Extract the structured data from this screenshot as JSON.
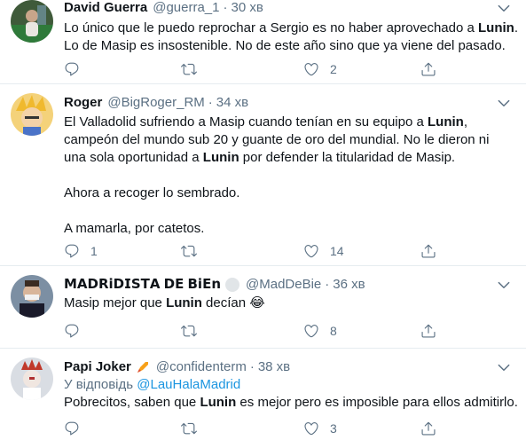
{
  "tweets": [
    {
      "name": "David Guerra",
      "handle": "@guerra_1",
      "sep": "·",
      "time": "30 хв",
      "lines": [
        [
          "Lo único que le puedo reprochar a Sergio es no haber aprovechado a ",
          "Lunin",
          "."
        ],
        [
          "Lo de Masip es insostenible. No de este año sino que ya viene del pasado.",
          "",
          ""
        ]
      ],
      "reply_count": "",
      "retweet_count": "",
      "like_count": "2"
    },
    {
      "name": "Roger",
      "handle": "@BigRoger_RM",
      "sep": "·",
      "time": "34 хв",
      "lines": [
        [
          "El Valladolid sufriendo a Masip cuando tenían en su equipo a ",
          "Lunin",
          ","
        ],
        [
          "campeón del mundo sub 20 y guante de oro del mundial. No le dieron ni",
          "",
          ""
        ],
        [
          "una sola oportunidad a ",
          "Lunin",
          " por defender la titularidad de Masip."
        ],
        [
          "",
          "",
          ""
        ],
        [
          "Ahora a recoger lo sembrado.",
          "",
          ""
        ],
        [
          "",
          "",
          ""
        ],
        [
          "A mamarla, por catetos.",
          "",
          ""
        ]
      ],
      "reply_count": "1",
      "retweet_count": "",
      "like_count": "14"
    },
    {
      "name": "𝗠𝗔𝗗𝗥𝗶𝗗𝗜𝗦𝗧𝗔 𝗗𝗘 𝗕𝗶𝗘𝗻",
      "handle": "@MadDeBie",
      "sep": "·",
      "time": "36 хв",
      "lines": [
        [
          "Masip mejor que ",
          "Lunin",
          " decían 😂"
        ]
      ],
      "reply_count": "",
      "retweet_count": "",
      "like_count": "8"
    },
    {
      "name": "Papi Joker",
      "handle": "@confidenterm",
      "sep": "·",
      "time": "38 хв",
      "reply_prefix": "У відповідь ",
      "reply_handle": "@LauHalaMadrid",
      "lines": [
        [
          "Pobrecitos, saben que ",
          "Lunin",
          " es mejor pero es imposible para ellos admitirlo."
        ]
      ],
      "reply_count": "",
      "retweet_count": "",
      "like_count": "3"
    }
  ],
  "icons": {
    "reply": "reply-icon",
    "retweet": "retweet-icon",
    "like": "heart-icon",
    "share": "share-icon",
    "more": "more-icon"
  },
  "colors": {
    "text": "#0f1419",
    "muted": "#5b7083",
    "link": "#1b95e0",
    "divider": "#e6ecf0"
  }
}
